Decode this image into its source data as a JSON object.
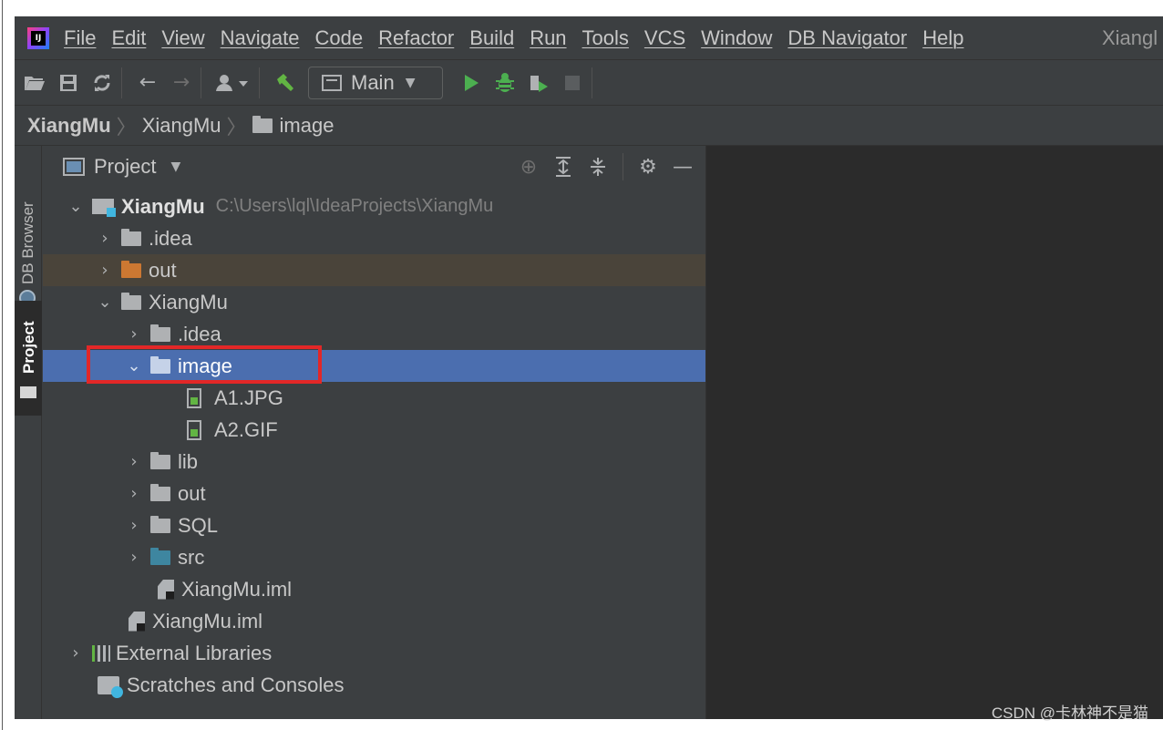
{
  "window": {
    "title": "Xiangl"
  },
  "menu": [
    {
      "label": "File",
      "underline": true
    },
    {
      "label": "Edit",
      "underline": true
    },
    {
      "label": "View",
      "underline": true
    },
    {
      "label": "Navigate",
      "underline": true
    },
    {
      "label": "Code",
      "underline": true
    },
    {
      "label": "Refactor",
      "underline": true
    },
    {
      "label": "Build",
      "underline": true
    },
    {
      "label": "Run",
      "underline": true
    },
    {
      "label": "Tools",
      "underline": true
    },
    {
      "label": "VCS",
      "underline": true
    },
    {
      "label": "Window",
      "underline": true
    },
    {
      "label": "DB Navigator",
      "underline": true
    },
    {
      "label": "Help",
      "underline": true
    }
  ],
  "toolbar": {
    "run_config": "Main",
    "icons": [
      "open-icon",
      "save-icon",
      "sync-icon",
      "back-icon",
      "forward-icon",
      "user-icon",
      "build-hammer-icon",
      "run-icon",
      "debug-icon",
      "coverage-icon",
      "stop-icon"
    ]
  },
  "breadcrumb": [
    "XiangMu",
    "XiangMu",
    "image"
  ],
  "tool_strip": {
    "db_browser": "DB Browser",
    "project": "Project"
  },
  "panel": {
    "title": "Project"
  },
  "tree": {
    "root_name": "XiangMu",
    "root_path": "C:\\Users\\lql\\IdeaProjects\\XiangMu",
    "idea": ".idea",
    "out_excluded": "out",
    "module": "XiangMu",
    "module_idea": ".idea",
    "image_folder": "image",
    "file_a1": "A1.JPG",
    "file_a2": "A2.GIF",
    "lib": "lib",
    "module_out": "out",
    "sql": "SQL",
    "src": "src",
    "module_iml": "XiangMu.iml",
    "root_iml": "XiangMu.iml",
    "external_libraries": "External Libraries",
    "scratches": "Scratches and Consoles"
  },
  "colors": {
    "selected_row": "#4b6eaf",
    "excluded_row": "#4a443a",
    "highlight_box": "#e32727",
    "run_green": "#4caf50"
  },
  "watermark": "CSDN @卡林神不是猫"
}
